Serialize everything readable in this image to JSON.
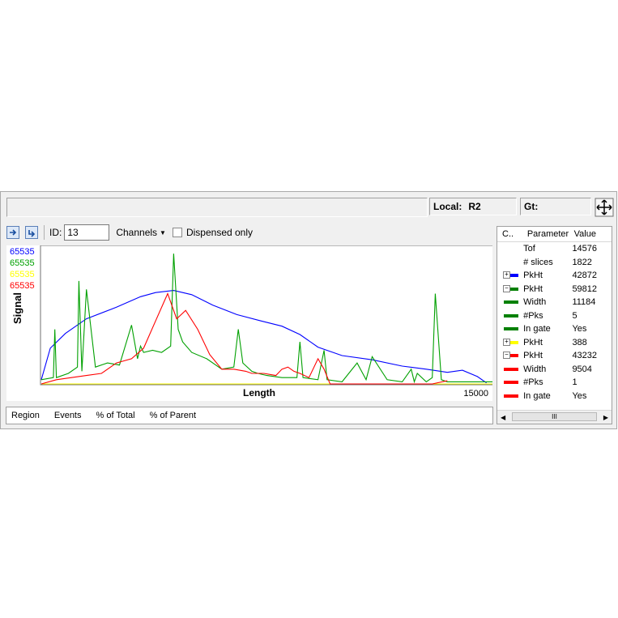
{
  "status": {
    "local_label": "Local:",
    "local_value": "R2",
    "gate_label": "Gt:",
    "gate_value": ""
  },
  "toolbar": {
    "id_label": "ID:",
    "id_value": "13",
    "channels_label": "Channels",
    "dispensed_label": "Dispensed only"
  },
  "chart": {
    "signal_values": [
      "65535",
      "65535",
      "65535",
      "65535"
    ],
    "colors": {
      "blue": "#0000ff",
      "green": "#00a000",
      "yellow": "#ffff00",
      "red": "#ff0000"
    },
    "ylabel": "Signal",
    "xlabel": "Length",
    "xmax_label": "15000"
  },
  "chart_data": {
    "type": "line",
    "xlabel": "Length",
    "ylabel": "Signal",
    "xlim": [
      0,
      15000
    ],
    "ylim": [
      0,
      65535
    ],
    "series": [
      {
        "color": "#0000ff",
        "x": [
          0,
          300,
          800,
          1500,
          2500,
          3300,
          3800,
          4400,
          5000,
          5700,
          6500,
          7300,
          8000,
          8600,
          9200,
          10000,
          11000,
          12000,
          12800,
          13500,
          14000,
          14500,
          14800
        ],
        "y": [
          2000,
          17000,
          24000,
          31000,
          36500,
          41500,
          43500,
          44500,
          42500,
          37500,
          33000,
          30000,
          27500,
          23500,
          17500,
          13500,
          11500,
          8500,
          7000,
          5500,
          6500,
          3500,
          500
        ]
      },
      {
        "color": "#00a000",
        "x": [
          0,
          400,
          450,
          500,
          900,
          1200,
          1250,
          1350,
          1500,
          1800,
          2200,
          2600,
          3000,
          3200,
          3300,
          3400,
          3700,
          4000,
          4300,
          4400,
          4550,
          4700,
          5000,
          5500,
          6000,
          6400,
          6550,
          6700,
          7000,
          7200,
          7500,
          8000,
          8500,
          8600,
          8700,
          9200,
          9400,
          9500,
          10000,
          10500,
          10800,
          11000,
          11500,
          12000,
          12300,
          12400,
          12500,
          12800,
          13000,
          13100,
          13300,
          13500,
          14000,
          14500,
          15000
        ],
        "y": [
          2000,
          3000,
          26000,
          3000,
          5000,
          8000,
          49000,
          6000,
          45000,
          8000,
          10000,
          9000,
          28000,
          12000,
          18000,
          15000,
          16000,
          15000,
          18000,
          62000,
          26000,
          20000,
          15000,
          12000,
          7000,
          8000,
          26000,
          10000,
          6000,
          5000,
          4000,
          3000,
          3000,
          20000,
          3000,
          2000,
          16000,
          2000,
          1000,
          10000,
          2000,
          13000,
          2000,
          1000,
          7000,
          1000,
          5000,
          1000,
          3000,
          43000,
          2000,
          1000,
          1000,
          1000,
          1000
        ]
      },
      {
        "color": "#ff0000",
        "x": [
          0,
          500,
          1000,
          1500,
          2000,
          2500,
          3000,
          3400,
          3800,
          4200,
          4500,
          4800,
          5200,
          5600,
          6000,
          6400,
          6800,
          7000,
          7400,
          7800,
          8000,
          8200,
          8400,
          8600,
          8900,
          9200,
          9400,
          9600,
          13000,
          13500
        ],
        "y": [
          0,
          2000,
          3000,
          4000,
          5000,
          10000,
          12000,
          17000,
          30000,
          43000,
          31000,
          35000,
          26000,
          14000,
          7000,
          7000,
          6000,
          5000,
          5000,
          4000,
          7000,
          8000,
          6000,
          5000,
          3000,
          12000,
          7000,
          0,
          0,
          1500
        ]
      },
      {
        "color": "#ffff00",
        "x": [
          0,
          15000
        ],
        "y": [
          0,
          0
        ]
      }
    ]
  },
  "bottom_grid": {
    "columns": [
      "Region",
      "Events",
      "% of Total",
      "% of Parent"
    ]
  },
  "side_grid": {
    "headers": {
      "c": "C..",
      "param": "Parameter",
      "value": "Value"
    },
    "rows": [
      {
        "param": "Tof",
        "value": "14576",
        "color": "",
        "toggle": ""
      },
      {
        "param": "# slices",
        "value": "1822",
        "color": "",
        "toggle": ""
      },
      {
        "param": "PkHt",
        "value": "42872",
        "color": "#0000ff",
        "toggle": "+"
      },
      {
        "param": "PkHt",
        "value": "59812",
        "color": "#008000",
        "toggle": "−"
      },
      {
        "param": "Width",
        "value": "11184",
        "color": "#008000",
        "toggle": ""
      },
      {
        "param": "#Pks",
        "value": "5",
        "color": "#008000",
        "toggle": ""
      },
      {
        "param": "In gate",
        "value": "Yes",
        "color": "#008000",
        "toggle": ""
      },
      {
        "param": "PkHt",
        "value": "388",
        "color": "#ffff00",
        "toggle": "+"
      },
      {
        "param": "PkHt",
        "value": "43232",
        "color": "#ff0000",
        "toggle": "−"
      },
      {
        "param": "Width",
        "value": "9504",
        "color": "#ff0000",
        "toggle": ""
      },
      {
        "param": "#Pks",
        "value": "1",
        "color": "#ff0000",
        "toggle": ""
      },
      {
        "param": "In gate",
        "value": "Yes",
        "color": "#ff0000",
        "toggle": ""
      }
    ],
    "scroll_thumb": "III"
  }
}
